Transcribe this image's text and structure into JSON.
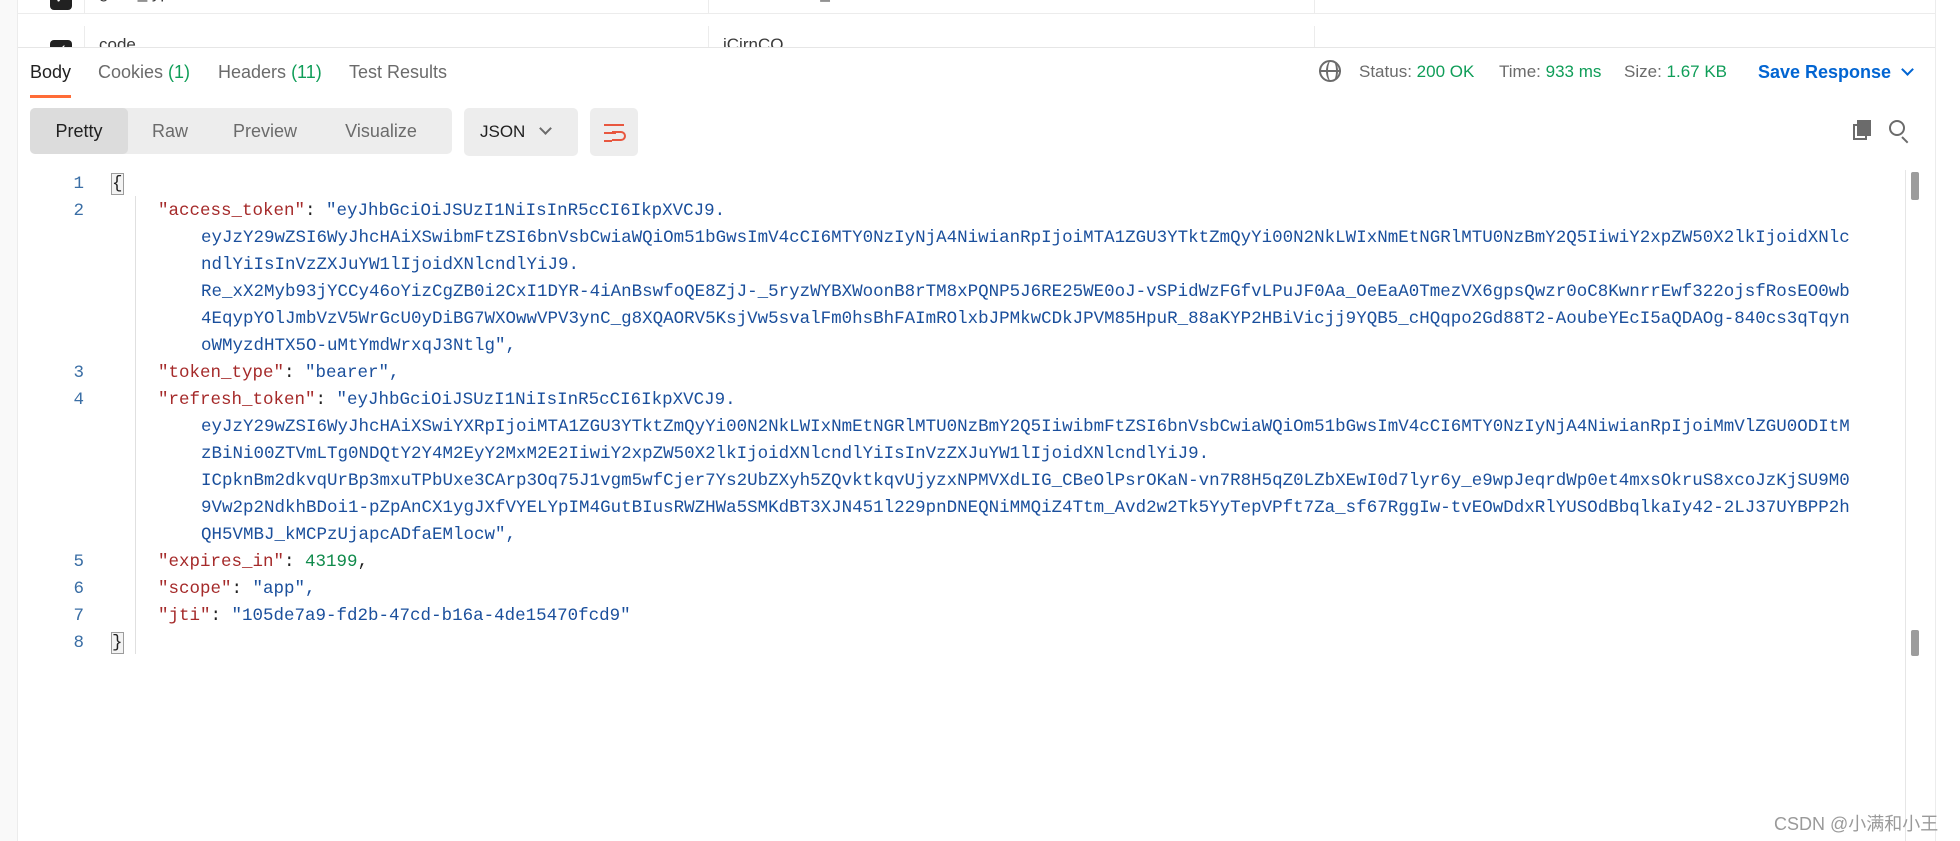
{
  "params": {
    "rows": [
      {
        "key": "grant_type",
        "value": "authorization_code"
      },
      {
        "key": "code",
        "value": "iCirnCO"
      }
    ]
  },
  "tabs": {
    "body": "Body",
    "cookies": "Cookies",
    "cookies_count": "(1)",
    "headers": "Headers",
    "headers_count": "(11)",
    "test_results": "Test Results"
  },
  "status": {
    "status_label": "Status:",
    "status_value": "200 OK",
    "time_label": "Time:",
    "time_value": "933 ms",
    "size_label": "Size:",
    "size_value": "1.67 KB",
    "save_response": "Save Response"
  },
  "toolbar": {
    "views": [
      "Pretty",
      "Raw",
      "Preview",
      "Visualize"
    ],
    "format": "JSON"
  },
  "code": {
    "lines": [
      {
        "n": "1",
        "text": "{"
      },
      {
        "n": "2",
        "key": "\"access_token\"",
        "val": "\"eyJhbGciOiJSUzI1NiIsInR5cCI6IkpXVCJ9.",
        "cont": [
          "eyJzY29wZSI6WyJhcHAiXSwibmFtZSI6bnVsbCwiaWQiOm51bGwsImV4cCI6MTY0NzIyNjA4NiwianRpIjoiMTA1ZGU3YTktZmQyYi00N2NkLWIxNmEtNGRlMTU0NzBmY2Q5IiwiY2xpZW50X2lkIjoidXNlc",
          "ndlYiIsInVzZXJuYW1lIjoidXNlcndlYiJ9.",
          "Re_xX2Myb93jYCCy46oYizCgZB0i2CxI1DYR-4iAnBswfoQE8ZjJ-_5ryzWYBXWoonB8rTM8xPQNP5J6RE25WE0oJ-vSPidWzFGfvLPuJF0Aa_OeEaA0TmezVX6gpsQwzr0oC8KwnrrEwf322ojsfRosEO0wb",
          "4EqypYOlJmbVzV5WrGcU0yDiBG7WXOwwVPV3ynC_g8XQAORV5KsjVw5svalFm0hsBhFAImROlxbJPMkwCDkJPVM85HpuR_88aKYP2HBiVicjj9YQB5_cHQqpo2Gd88T2-AoubeYEcI5aQDAOg-840cs3qTqyn",
          "oWMyzdHTX5O-uMtYmdWrxqJ3Ntlg\","
        ]
      },
      {
        "n": "3",
        "key": "\"token_type\"",
        "val": "\"bearer\","
      },
      {
        "n": "4",
        "key": "\"refresh_token\"",
        "val": "\"eyJhbGciOiJSUzI1NiIsInR5cCI6IkpXVCJ9.",
        "cont": [
          "eyJzY29wZSI6WyJhcHAiXSwiYXRpIjoiMTA1ZGU3YTktZmQyYi00N2NkLWIxNmEtNGRlMTU0NzBmY2Q5IiwibmFtZSI6bnVsbCwiaWQiOm51bGwsImV4cCI6MTY0NzIyNjA4NiwianRpIjoiMmVlZGU0ODItM",
          "zBiNi00ZTVmLTg0NDQtY2Y4M2EyY2MxM2E2IiwiY2xpZW50X2lkIjoidXNlcndlYiIsInVzZXJuYW1lIjoidXNlcndlYiJ9.",
          "ICpknBm2dkvqUrBp3mxuTPbUxe3CArp3Oq75J1vgm5wfCjer7Ys2UbZXyh5ZQvktkqvUjyzxNPMVXdLIG_CBeOlPsrOKaN-vn7R8H5qZ0LZbXEwI0d7lyr6y_e9wpJeqrdWp0et4mxsOkruS8xcoJzKjSU9M0",
          "9Vw2p2NdkhBDoi1-pZpAnCX1ygJXfVYELYpIM4GutBIusRWZHWa5SMKdBT3XJN451l229pnDNEQNiMMQiZ4Ttm_Avd2w2Tk5YyTepVPft7Za_sf67RggIw-tvEOwDdxRlYUSOdBbqlkaIy42-2LJ37UYBPP2h",
          "QH5VMBJ_kMCPzUjapcADfaEMlocw\","
        ]
      },
      {
        "n": "5",
        "key": "\"expires_in\"",
        "num": "43199",
        "tail": ","
      },
      {
        "n": "6",
        "key": "\"scope\"",
        "val": "\"app\","
      },
      {
        "n": "7",
        "key": "\"jti\"",
        "val": "\"105de7a9-fd2b-47cd-b16a-4de15470fcd9\""
      },
      {
        "n": "8",
        "text": "}"
      }
    ]
  },
  "watermark": "CSDN @小满和小王"
}
